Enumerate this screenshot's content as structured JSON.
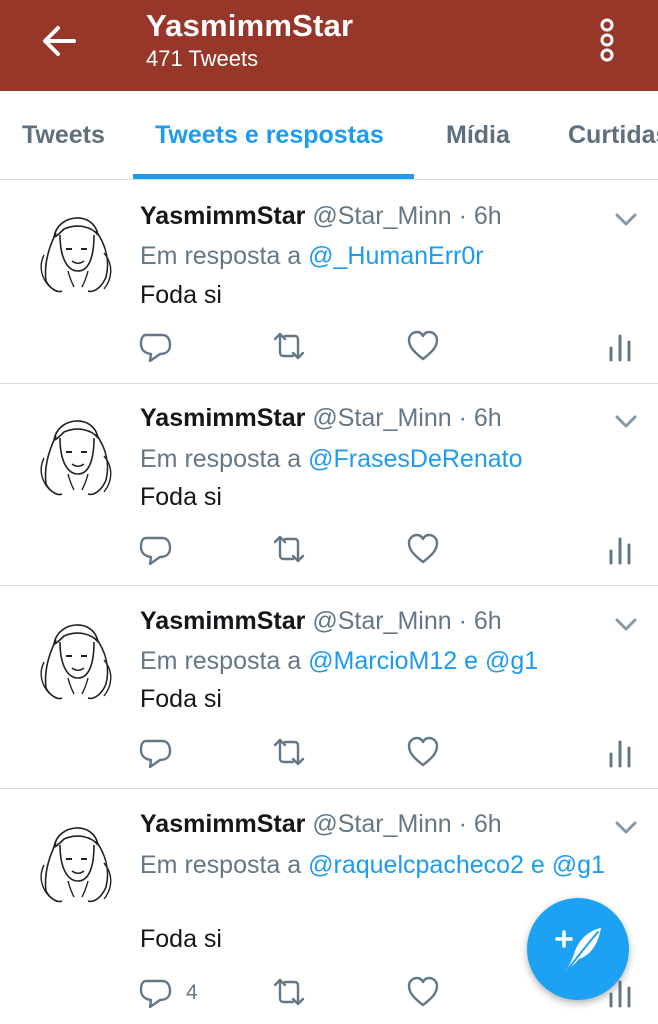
{
  "header": {
    "title": "YasmimmStar",
    "subtitle": "471 Tweets",
    "back_icon": "arrow-left-icon",
    "more_icon": "more-vertical-icon",
    "background_color": "#963729"
  },
  "tabs": [
    {
      "label": "Tweets",
      "active": false
    },
    {
      "label": "Tweets e respostas",
      "active": true
    },
    {
      "label": "Mídia",
      "active": false
    },
    {
      "label": "Curtidas",
      "active": false
    }
  ],
  "tweets": [
    {
      "name": "YasmimmStar",
      "handle": "@Star_Minn",
      "time": "· 6h",
      "reply_prefix": "Em resposta a",
      "mention1": "@_HumanErr0r",
      "joiner": "",
      "mention2": "",
      "text": "Foda si",
      "reply_count": ""
    },
    {
      "name": "YasmimmStar",
      "handle": "@Star_Minn",
      "time": "· 6h",
      "reply_prefix": "Em resposta a",
      "mention1": "@FrasesDeRenato",
      "joiner": "",
      "mention2": "",
      "text": "Foda si",
      "reply_count": ""
    },
    {
      "name": "YasmimmStar",
      "handle": "@Star_Minn",
      "time": "· 6h",
      "reply_prefix": "Em resposta a",
      "mention1": "@MarcioM12",
      "joiner": "e",
      "mention2": "@g1",
      "text": "Foda si",
      "reply_count": ""
    },
    {
      "name": "YasmimmStar",
      "handle": "@Star_Minn",
      "time": "· 6h",
      "reply_prefix": "Em resposta a",
      "mention1": "@raquelcpacheco2",
      "joiner": "e",
      "mention2": "@g1",
      "text": "Foda si",
      "reply_count": "4"
    }
  ],
  "fab": {
    "icon": "compose-feather-icon"
  },
  "colors": {
    "accent": "#1d9bf0",
    "muted": "#657786",
    "divider": "#d8dde1"
  }
}
